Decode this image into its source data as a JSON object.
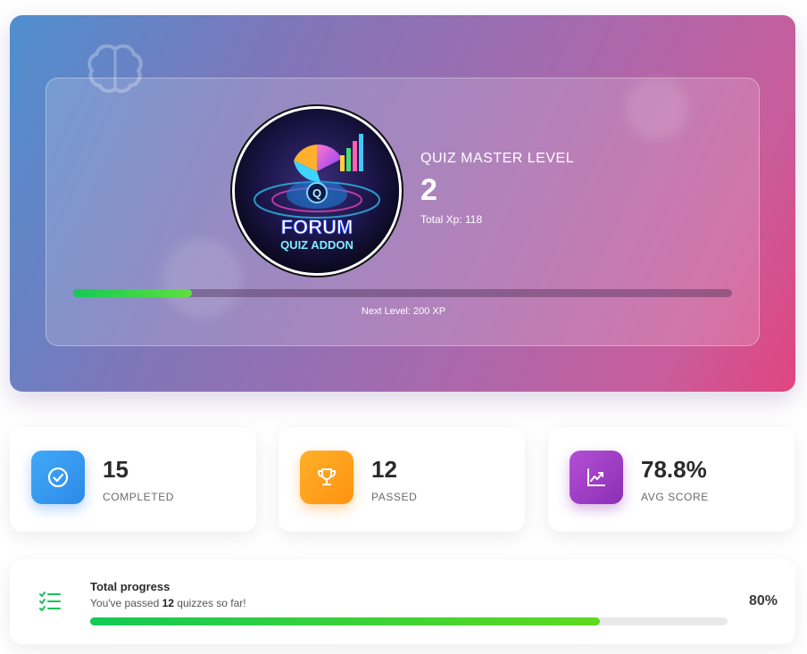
{
  "hero": {
    "level_label": "QUIZ MASTER LEVEL",
    "level": "2",
    "total_xp": "Total Xp: 118",
    "xp_progress_percent": 18,
    "next_level": "Next Level: 200 XP",
    "logo": {
      "line1": "FORUM",
      "line2": "QUIZ ADDON",
      "badge": "Q"
    }
  },
  "stats": [
    {
      "value": "15",
      "label": "COMPLETED",
      "icon": "check-circle-icon",
      "color": "#3b9cf0"
    },
    {
      "value": "12",
      "label": "PASSED",
      "icon": "trophy-icon",
      "color": "#ff9f1a"
    },
    {
      "value": "78.8%",
      "label": "AVG SCORE",
      "icon": "trend-chart-icon",
      "color": "#a03fc4"
    }
  ],
  "progress": {
    "title": "Total progress",
    "sub_prefix": "You've passed ",
    "sub_count": "12",
    "sub_suffix": " quizzes so far!",
    "percent_label": "80%",
    "percent": 80
  },
  "colors": {
    "accent_green": "#14c956",
    "hero_gradient_start": "#4f8fd0",
    "hero_gradient_end": "#e0457f"
  }
}
